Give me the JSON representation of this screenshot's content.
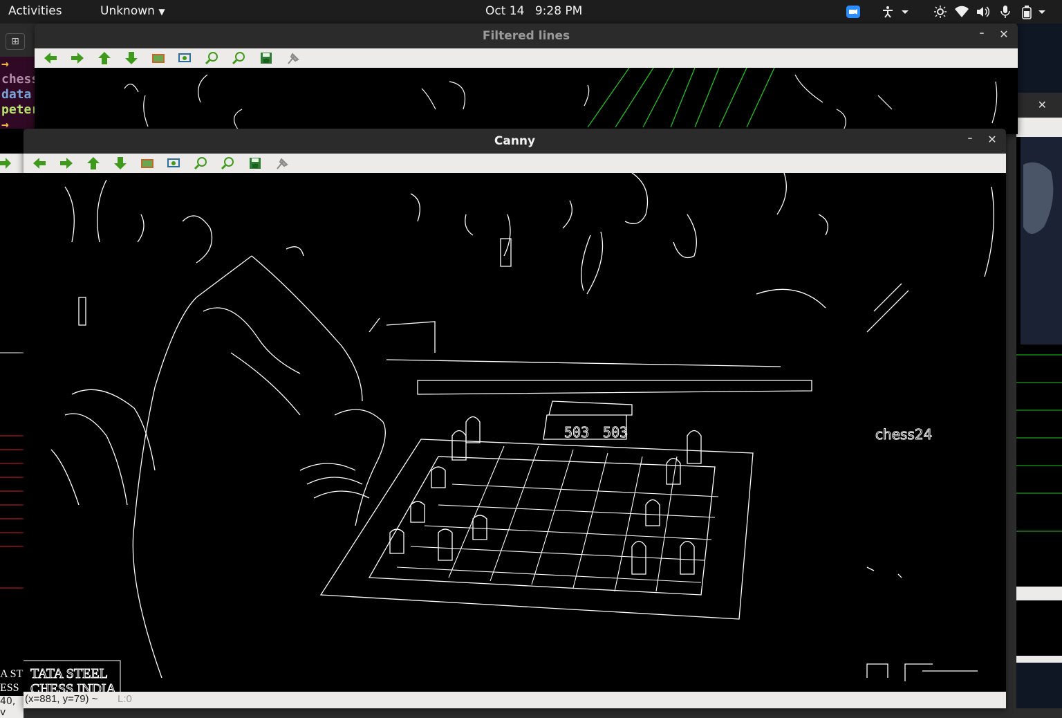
{
  "topbar": {
    "activities": "Activities",
    "app_menu": "Unknown",
    "date": "Oct 14",
    "time": "9:28 PM"
  },
  "terminal": {
    "lines": [
      {
        "text": "→",
        "color": "#f6b73c"
      },
      {
        "text": "chess",
        "color": "#b48ead"
      },
      {
        "text": "data",
        "color": "#7aa6da"
      },
      {
        "text": "peter",
        "color": "#b5e36b"
      },
      {
        "text": "→",
        "color": "#f6b73c"
      }
    ]
  },
  "filtered_window": {
    "title": "Filtered lines",
    "line_color": "#22c322"
  },
  "canny_window": {
    "title": "Canny",
    "image_text": {
      "watermark": "chess24",
      "clock_left": "503",
      "clock_right": "503",
      "logo_line1": "TATA STEEL",
      "logo_line2": "CHESS INDIA"
    },
    "status": "(x=881, y=79) ~",
    "status_value": "L:0"
  },
  "toolbar_icons": [
    "arrow-left-icon",
    "arrow-right-icon",
    "arrow-up-icon",
    "arrow-down-icon",
    "image-icon",
    "zoom-fit-icon",
    "zoom-in-icon",
    "zoom-out-icon",
    "save-icon",
    "properties-icon"
  ],
  "left_window_fragments": {
    "logo_partial_1": "A ST",
    "logo_partial_2": "ESS IN",
    "status_partial": "40, v"
  }
}
